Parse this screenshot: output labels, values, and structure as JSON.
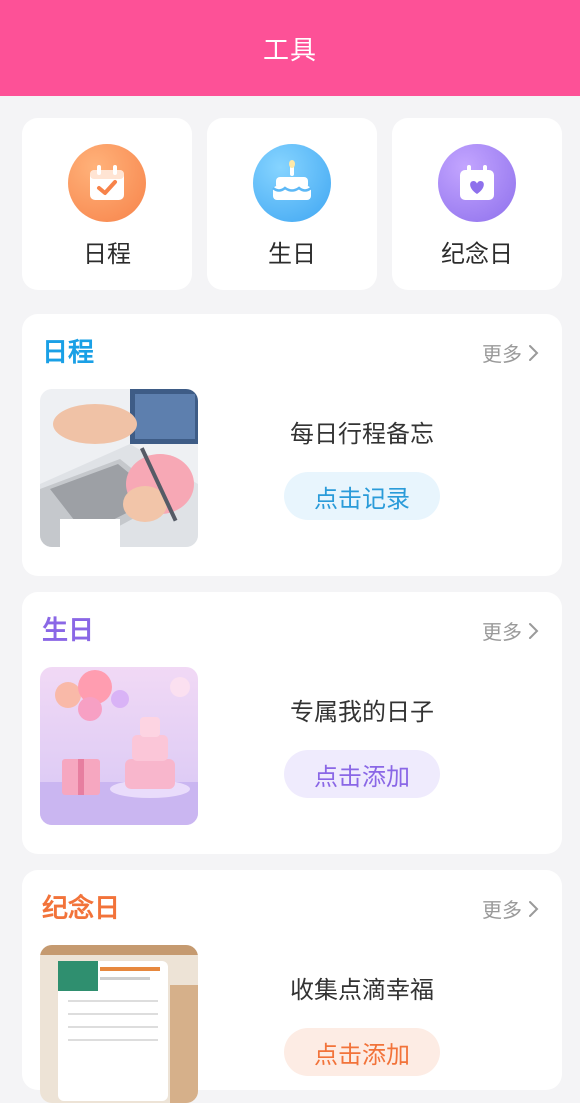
{
  "header": {
    "title": "工具"
  },
  "tools": [
    {
      "label": "日程",
      "icon": "calendar-check-icon"
    },
    {
      "label": "生日",
      "icon": "birthday-cake-icon"
    },
    {
      "label": "纪念日",
      "icon": "calendar-heart-icon"
    }
  ],
  "sections": [
    {
      "title": "日程",
      "title_color": "#1aa0e6",
      "more": "更多",
      "description": "每日行程备忘",
      "button": "点击记录",
      "button_bg": "#e8f5fd",
      "button_color": "#2a9bd9"
    },
    {
      "title": "生日",
      "title_color": "#8a67e6",
      "more": "更多",
      "description": "专属我的日子",
      "button": "点击添加",
      "button_bg": "#efebfd",
      "button_color": "#8a67e6"
    },
    {
      "title": "纪念日",
      "title_color": "#f2733a",
      "more": "更多",
      "description": "收集点滴幸福",
      "button": "点击添加",
      "button_bg": "#fdece4",
      "button_color": "#f2733a"
    }
  ],
  "colors": {
    "header_bg": "#fd5197",
    "page_bg": "#f4f4f6"
  }
}
